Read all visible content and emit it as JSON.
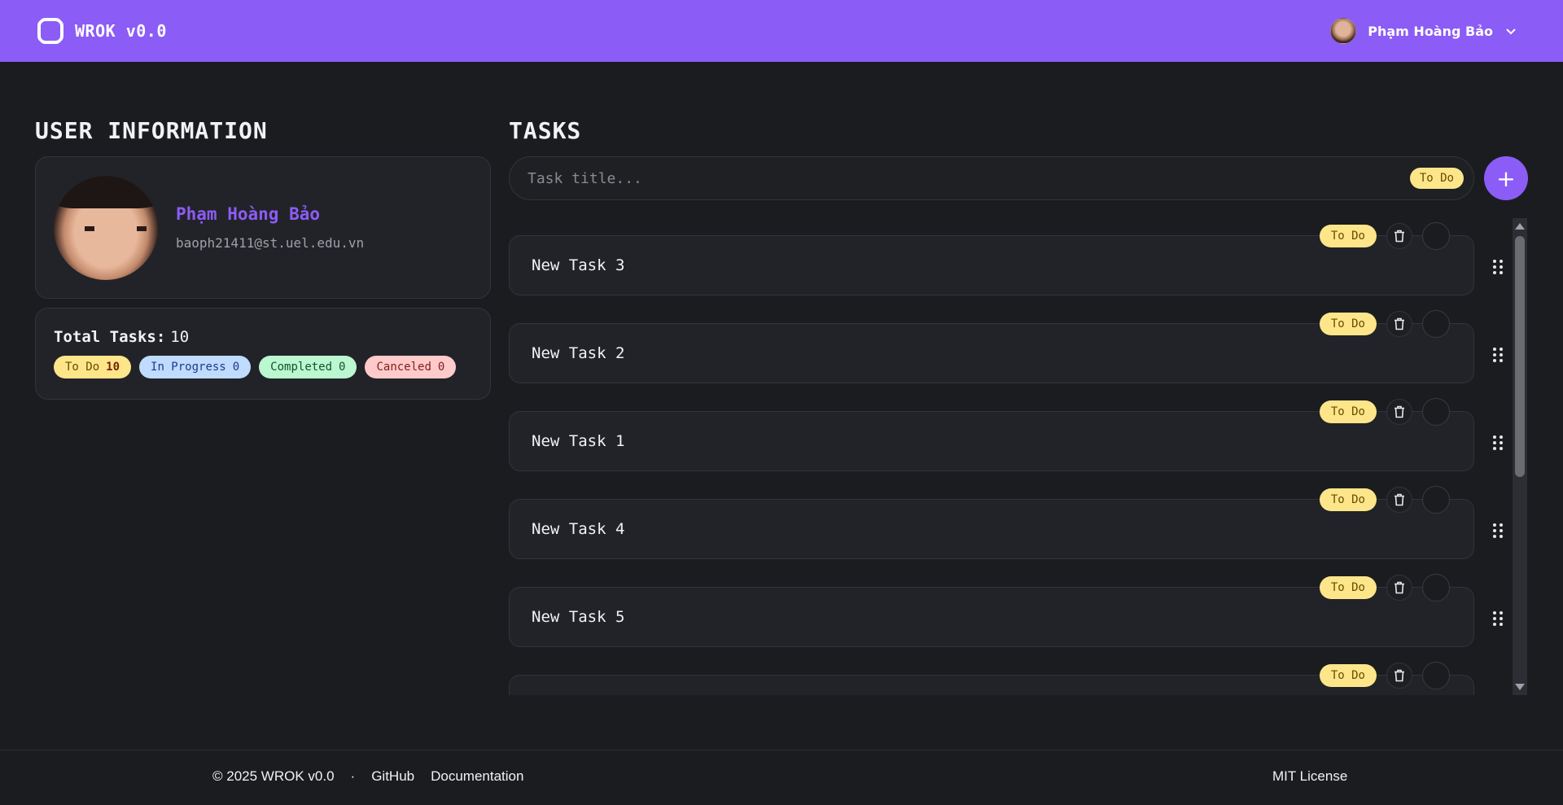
{
  "header": {
    "brand_name": "WROK v0.0",
    "user_name": "Phạm Hoàng Bảo"
  },
  "user_info": {
    "section_title": "USER INFORMATION",
    "name": "Phạm Hoàng Bảo",
    "email": "baoph21411@st.uel.edu.vn",
    "total_label": "Total Tasks:",
    "total_value": "10",
    "badges": [
      {
        "label": "To Do",
        "count": "10"
      },
      {
        "label": "In Progress",
        "count": "0"
      },
      {
        "label": "Completed",
        "count": "0"
      },
      {
        "label": "Canceled",
        "count": "0"
      }
    ]
  },
  "tasks": {
    "section_title": "TASKS",
    "input_placeholder": "Task title...",
    "input_status": "To Do",
    "add_label": "+",
    "items": [
      {
        "title": "New Task 3",
        "status": "To Do"
      },
      {
        "title": "New Task 2",
        "status": "To Do"
      },
      {
        "title": "New Task 1",
        "status": "To Do"
      },
      {
        "title": "New Task 4",
        "status": "To Do"
      },
      {
        "title": "New Task 5",
        "status": "To Do"
      },
      {
        "title": "",
        "status": "To Do"
      }
    ]
  },
  "footer": {
    "copyright": "© 2025 WROK v0.0",
    "separator": "·",
    "github": "GitHub",
    "docs": "Documentation",
    "license": "MIT License"
  },
  "colors": {
    "accent": "#8b5cf6",
    "background": "#1b1c20",
    "todo": "#fde68a",
    "in_progress": "#bfdbfe",
    "completed": "#bbf7d0",
    "canceled": "#fecaca"
  }
}
